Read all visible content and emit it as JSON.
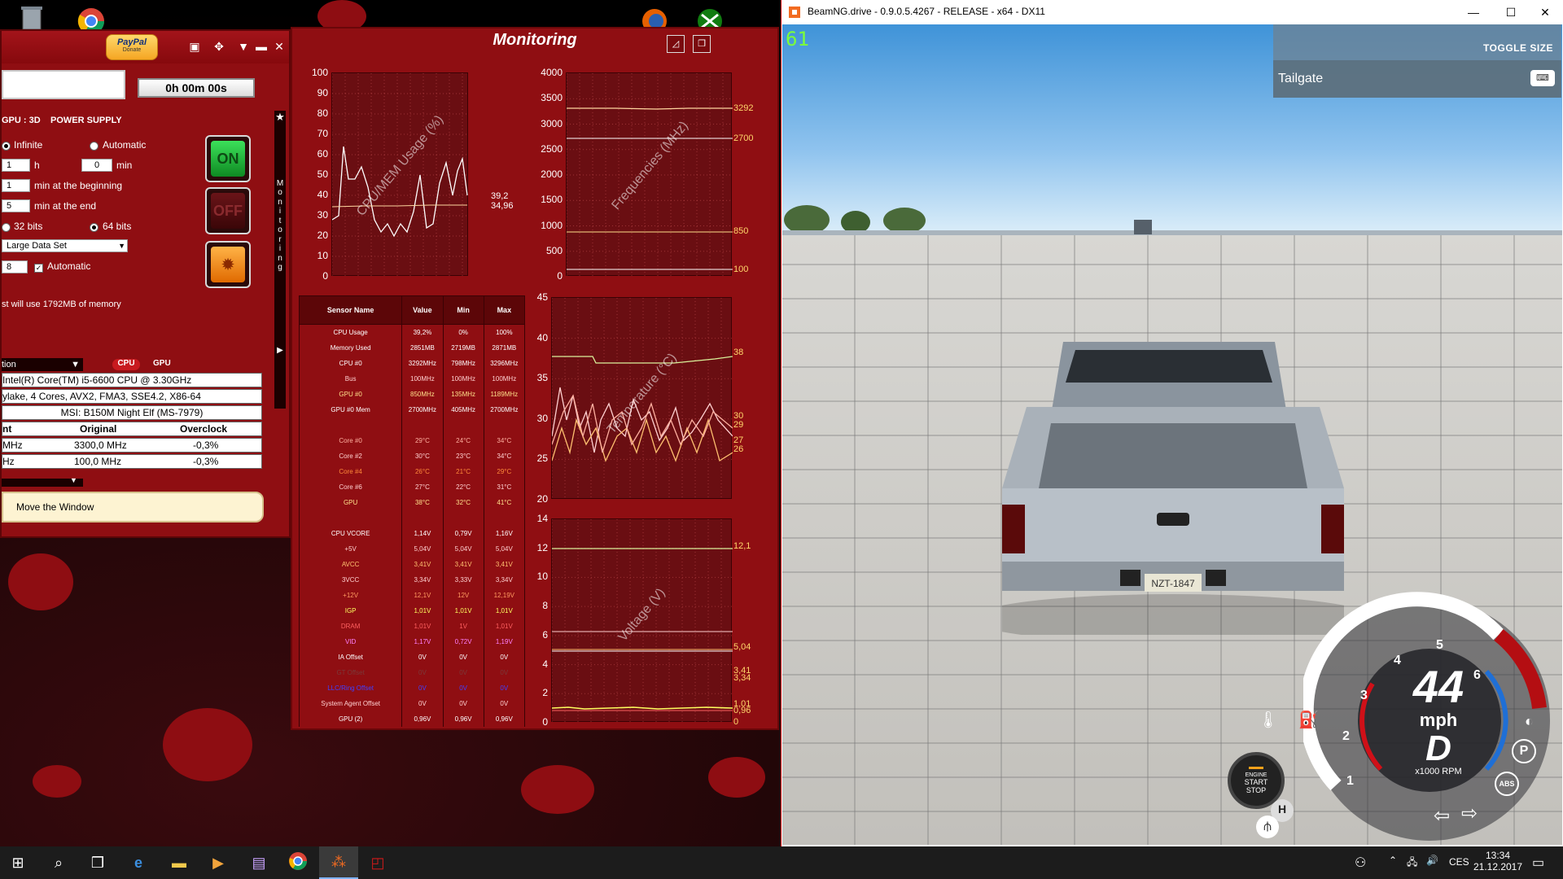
{
  "occt": {
    "paypal_label": "PayPal",
    "donate_label": "Donate",
    "timer": "0h 00m 00s",
    "tabs": [
      "GPU : 3D",
      "POWER SUPPLY"
    ],
    "duration": {
      "infinite_label": "Infinite",
      "automatic_label": "Automatic",
      "hours_value": "1",
      "hours_unit": "h",
      "minutes_value": "0",
      "minutes_unit": "min",
      "begin_value": "1",
      "begin_label": "min at the beginning",
      "end_value": "5",
      "end_label": "min at the end",
      "bits32_label": "32 bits",
      "bits64_label": "64 bits",
      "dataset_value": "Large Data Set",
      "threads_value": "8",
      "threads_auto_label": "Automatic",
      "memory_note": "st will use 1792MB of memory"
    },
    "buttons": {
      "on_label": "ON",
      "off_label": "OFF"
    },
    "info": {
      "section_label": "tion",
      "cpu_tab": "CPU",
      "gpu_tab": "GPU",
      "rows": [
        "Intel(R) Core(TM) i5-6600 CPU @ 3.30GHz",
        "ylake, 4 Cores, AVX2, FMA3, SSE4.2, X86-64",
        "MSI: B150M Night Elf (MS-7979)"
      ],
      "clock_headers": [
        "nt",
        "Original",
        "Overclock"
      ],
      "clock_rows": [
        [
          "MHz",
          "3300,0 MHz",
          "-0,3%"
        ],
        [
          "Hz",
          "100,0 MHz",
          "-0,3%"
        ]
      ]
    },
    "move_window_label": "Move the Window",
    "vertical_tab": "Monitoring"
  },
  "monitoring": {
    "title": "Monitoring",
    "graphs": {
      "cpu_mem": {
        "title": "CPU/MEM Usage (%)",
        "ticks": [
          "100",
          "90",
          "80",
          "70",
          "60",
          "50",
          "40",
          "30",
          "20",
          "10",
          "0"
        ],
        "readouts": [
          "39,2",
          "34,96"
        ]
      },
      "freq": {
        "title": "Frequencies (MHz)",
        "ticks": [
          "4000",
          "3500",
          "3000",
          "2500",
          "2000",
          "1500",
          "1000",
          "500",
          "0"
        ],
        "readouts": [
          "3292",
          "2700",
          "850",
          "100"
        ]
      },
      "temp": {
        "title": "Temperature (°C)",
        "ticks": [
          "45",
          "40",
          "35",
          "30",
          "25",
          "20"
        ],
        "readouts": [
          "38",
          "30",
          "29",
          "27",
          "26"
        ]
      },
      "volt": {
        "title": "Voltage (V)",
        "ticks": [
          "14",
          "12",
          "10",
          "8",
          "6",
          "4",
          "2",
          "0"
        ],
        "readouts": [
          "12,1",
          "5,04",
          "3,41",
          "3,34",
          "1,01",
          "0,96",
          "0"
        ]
      }
    },
    "table": {
      "headers": [
        "Sensor Name",
        "Value",
        "Min",
        "Max"
      ],
      "rows": [
        {
          "n": "CPU Usage",
          "v": "39,2%",
          "mi": "0%",
          "ma": "100%",
          "c": "#ffffff"
        },
        {
          "n": "Memory Used",
          "v": "2851MB",
          "mi": "2719MB",
          "ma": "2871MB",
          "c": "#ffffff"
        },
        {
          "n": "CPU #0",
          "v": "3292MHz",
          "mi": "798MHz",
          "ma": "3296MHz",
          "c": "#ffffff"
        },
        {
          "n": "Bus",
          "v": "100MHz",
          "mi": "100MHz",
          "ma": "100MHz",
          "c": "#ffd0d0"
        },
        {
          "n": "GPU #0",
          "v": "850MHz",
          "mi": "135MHz",
          "ma": "1189MHz",
          "c": "#ffe08a"
        },
        {
          "n": "GPU #0 Mem",
          "v": "2700MHz",
          "mi": "405MHz",
          "ma": "2700MHz",
          "c": "#ffffff"
        },
        {
          "n": "",
          "v": "",
          "mi": "",
          "ma": "",
          "c": "#ffffff"
        },
        {
          "n": "Core #0",
          "v": "29°C",
          "mi": "24°C",
          "ma": "34°C",
          "c": "#ffb0a0"
        },
        {
          "n": "Core #2",
          "v": "30°C",
          "mi": "23°C",
          "ma": "34°C",
          "c": "#ffd0d0"
        },
        {
          "n": "Core #4",
          "v": "26°C",
          "mi": "21°C",
          "ma": "29°C",
          "c": "#ff8a3a"
        },
        {
          "n": "Core #6",
          "v": "27°C",
          "mi": "22°C",
          "ma": "31°C",
          "c": "#ffd0d0"
        },
        {
          "n": "GPU",
          "v": "38°C",
          "mi": "32°C",
          "ma": "41°C",
          "c": "#ffe08a"
        },
        {
          "n": "",
          "v": "",
          "mi": "",
          "ma": "",
          "c": "#ffffff"
        },
        {
          "n": "CPU VCORE",
          "v": "1,14V",
          "mi": "0,79V",
          "ma": "1,16V",
          "c": "#ffffff"
        },
        {
          "n": "+5V",
          "v": "5,04V",
          "mi": "5,04V",
          "ma": "5,04V",
          "c": "#ffd0d0"
        },
        {
          "n": "AVCC",
          "v": "3,41V",
          "mi": "3,41V",
          "ma": "3,41V",
          "c": "#ffc070"
        },
        {
          "n": "3VCC",
          "v": "3,34V",
          "mi": "3,33V",
          "ma": "3,34V",
          "c": "#ffd0d0"
        },
        {
          "n": "+12V",
          "v": "12,1V",
          "mi": "12V",
          "ma": "12,19V",
          "c": "#ff9a60"
        },
        {
          "n": "IGP",
          "v": "1,01V",
          "mi": "1,01V",
          "ma": "1,01V",
          "c": "#ffff60"
        },
        {
          "n": "DRAM",
          "v": "1,01V",
          "mi": "1V",
          "ma": "1,01V",
          "c": "#ff6060"
        },
        {
          "n": "VID",
          "v": "1,17V",
          "mi": "0,72V",
          "ma": "1,19V",
          "c": "#ff80ff"
        },
        {
          "n": "IA Offset",
          "v": "0V",
          "mi": "0V",
          "ma": "0V",
          "c": "#ffffff"
        },
        {
          "n": "GT Offset",
          "v": "0V",
          "mi": "0V",
          "ma": "0V",
          "c": "#7a3a3a"
        },
        {
          "n": "LLC/Ring Offset",
          "v": "0V",
          "mi": "0V",
          "ma": "0V",
          "c": "#4040ff"
        },
        {
          "n": "System Agent Offset",
          "v": "0V",
          "mi": "0V",
          "ma": "0V",
          "c": "#ffd0d0"
        },
        {
          "n": "GPU (2)",
          "v": "0,96V",
          "mi": "0,96V",
          "ma": "0,96V",
          "c": "#ffffff"
        }
      ]
    }
  },
  "beamng": {
    "window_title": "BeamNG.drive - 0.9.0.5.4267 - RELEASE - x64 - DX11",
    "fps": "61",
    "toggle_size_label": "TOGGLE SIZE",
    "tailgate_label": "Tailgate",
    "plate": "NZT-1847",
    "engine_button": {
      "line1": "ENGINE",
      "line2": "START",
      "line3": "STOP"
    },
    "gauge": {
      "speed": "44",
      "unit": "mph",
      "gear": "D",
      "rpm_label": "x1000 RPM",
      "ticks": [
        "1",
        "2",
        "3",
        "4",
        "5",
        "6"
      ],
      "abs_label": "ABS",
      "parking_label": "P",
      "h_label": "H"
    }
  },
  "taskbar": {
    "lang": "CES",
    "time": "13:34",
    "date": "21.12.2017"
  },
  "colors": {
    "occt_red": "#8f0e12",
    "graph_bg": "#6a0e12",
    "fps_green": "#7cff3a",
    "readout_yellow": "#ffd76b"
  }
}
